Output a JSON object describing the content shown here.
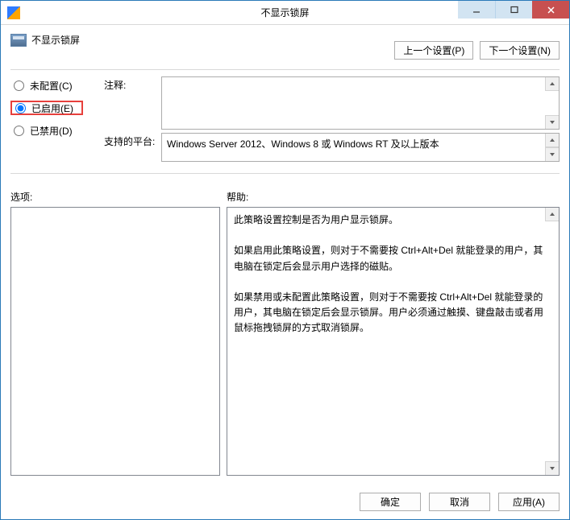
{
  "title": "不显示锁屏",
  "header": {
    "policy_title": "不显示锁屏",
    "prev_button": "上一个设置(P)",
    "next_button": "下一个设置(N)"
  },
  "radios": {
    "not_configured": "未配置(C)",
    "enabled": "已启用(E)",
    "disabled": "已禁用(D)",
    "selected": "enabled"
  },
  "labels": {
    "comment": "注释:",
    "platform": "支持的平台:",
    "options": "选项:",
    "help": "帮助:"
  },
  "comment_text": "",
  "platform_text": "Windows Server 2012、Windows 8 或 Windows RT 及以上版本",
  "options_text": "",
  "help_text": "此策略设置控制是否为用户显示锁屏。\n\n如果启用此策略设置，则对于不需要按 Ctrl+Alt+Del 就能登录的用户，其电脑在锁定后会显示用户选择的磁贴。\n\n如果禁用或未配置此策略设置，则对于不需要按 Ctrl+Alt+Del 就能登录的用户，其电脑在锁定后会显示锁屏。用户必须通过触摸、键盘敲击或者用鼠标拖拽锁屏的方式取消锁屏。",
  "footer": {
    "ok": "确定",
    "cancel": "取消",
    "apply": "应用(A)"
  }
}
